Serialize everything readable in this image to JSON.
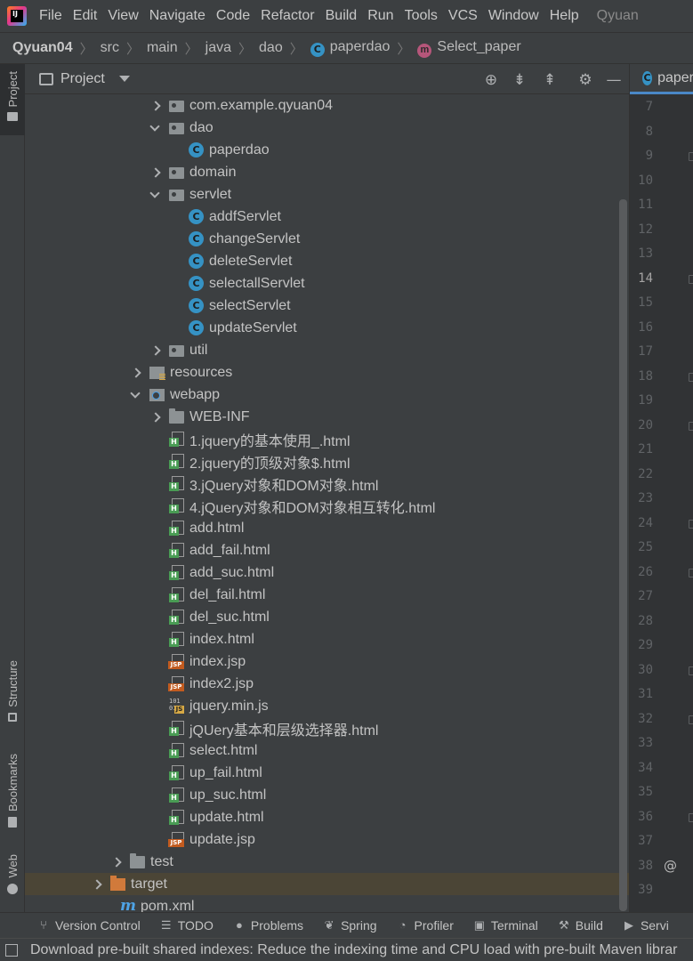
{
  "menubar": {
    "items": [
      "File",
      "Edit",
      "View",
      "Navigate",
      "Code",
      "Refactor",
      "Build",
      "Run",
      "Tools",
      "VCS",
      "Window",
      "Help"
    ],
    "title": "Qyuan"
  },
  "breadcrumb": {
    "project": "Qyuan04",
    "parts": [
      "src",
      "main",
      "java",
      "dao"
    ],
    "class_name": "paperdao",
    "method_name": "Select_paper"
  },
  "left_strip": {
    "project": "Project",
    "structure": "Structure",
    "bookmarks": "Bookmarks",
    "web": "Web"
  },
  "panel": {
    "title": "Project",
    "icons": [
      "locate-icon",
      "expand-all-icon",
      "collapse-all-icon",
      "gear-icon",
      "minimize-icon"
    ]
  },
  "tree": [
    {
      "label": "com.example.qyuan04",
      "icon": "package-icon",
      "arrow": "right",
      "depth": 2
    },
    {
      "label": "dao",
      "icon": "package-icon",
      "arrow": "down",
      "depth": 2
    },
    {
      "label": "paperdao",
      "icon": "class-icon",
      "arrow": "",
      "depth": 3
    },
    {
      "label": "domain",
      "icon": "package-icon",
      "arrow": "right",
      "depth": 2
    },
    {
      "label": "servlet",
      "icon": "package-icon",
      "arrow": "down",
      "depth": 2
    },
    {
      "label": "addfServlet",
      "icon": "class-icon",
      "arrow": "",
      "depth": 3
    },
    {
      "label": "changeServlet",
      "icon": "class-icon",
      "arrow": "",
      "depth": 3
    },
    {
      "label": "deleteServlet",
      "icon": "class-icon",
      "arrow": "",
      "depth": 3
    },
    {
      "label": "selectallServlet",
      "icon": "class-icon",
      "arrow": "",
      "depth": 3
    },
    {
      "label": "selectServlet",
      "icon": "class-icon",
      "arrow": "",
      "depth": 3
    },
    {
      "label": "updateServlet",
      "icon": "class-icon",
      "arrow": "",
      "depth": 3
    },
    {
      "label": "util",
      "icon": "package-icon",
      "arrow": "right",
      "depth": 2
    },
    {
      "label": "resources",
      "icon": "resources-folder-icon",
      "arrow": "right",
      "depth": 1
    },
    {
      "label": "webapp",
      "icon": "web-folder-icon",
      "arrow": "down",
      "depth": 1
    },
    {
      "label": "WEB-INF",
      "icon": "folder-icon",
      "arrow": "right",
      "depth": 2
    },
    {
      "label": "1.jquery的基本使用_.html",
      "icon": "html-file-icon",
      "arrow": "",
      "depth": 2
    },
    {
      "label": "2.jquery的顶级对象$.html",
      "icon": "html-file-icon",
      "arrow": "",
      "depth": 2
    },
    {
      "label": "3.jQuery对象和DOM对象.html",
      "icon": "html-file-icon",
      "arrow": "",
      "depth": 2
    },
    {
      "label": "4.jQuery对象和DOM对象相互转化.html",
      "icon": "html-file-icon",
      "arrow": "",
      "depth": 2
    },
    {
      "label": "add.html",
      "icon": "html-file-icon",
      "arrow": "",
      "depth": 2
    },
    {
      "label": "add_fail.html",
      "icon": "html-file-icon",
      "arrow": "",
      "depth": 2
    },
    {
      "label": "add_suc.html",
      "icon": "html-file-icon",
      "arrow": "",
      "depth": 2
    },
    {
      "label": "del_fail.html",
      "icon": "html-file-icon",
      "arrow": "",
      "depth": 2
    },
    {
      "label": "del_suc.html",
      "icon": "html-file-icon",
      "arrow": "",
      "depth": 2
    },
    {
      "label": "index.html",
      "icon": "html-file-icon",
      "arrow": "",
      "depth": 2
    },
    {
      "label": "index.jsp",
      "icon": "jsp-file-icon",
      "arrow": "",
      "depth": 2
    },
    {
      "label": "index2.jsp",
      "icon": "jsp-file-icon",
      "arrow": "",
      "depth": 2
    },
    {
      "label": "jquery.min.js",
      "icon": "js-file-icon",
      "arrow": "",
      "depth": 2
    },
    {
      "label": "jQUery基本和层级选择器.html",
      "icon": "html-file-icon",
      "arrow": "",
      "depth": 2
    },
    {
      "label": "select.html",
      "icon": "html-file-icon",
      "arrow": "",
      "depth": 2
    },
    {
      "label": "up_fail.html",
      "icon": "html-file-icon",
      "arrow": "",
      "depth": 2
    },
    {
      "label": "up_suc.html",
      "icon": "html-file-icon",
      "arrow": "",
      "depth": 2
    },
    {
      "label": "update.html",
      "icon": "html-file-icon",
      "arrow": "",
      "depth": 2
    },
    {
      "label": "update.jsp",
      "icon": "jsp-file-icon",
      "arrow": "",
      "depth": 2
    },
    {
      "label": "test",
      "icon": "folder-icon",
      "arrow": "right",
      "depth": 0
    },
    {
      "label": "target",
      "icon": "excluded-folder-icon",
      "arrow": "right",
      "depth": -1,
      "selected": true
    },
    {
      "label": "pom.xml",
      "icon": "maven-icon",
      "arrow": "",
      "depth": -0.5
    }
  ],
  "editor": {
    "tab_label": "paper",
    "line_numbers": [
      "7",
      "8",
      "9",
      "10",
      "11",
      "12",
      "13",
      "14",
      "15",
      "16",
      "17",
      "18",
      "19",
      "20",
      "21",
      "22",
      "23",
      "24",
      "25",
      "26",
      "27",
      "28",
      "29",
      "30",
      "31",
      "32",
      "33",
      "34",
      "35",
      "36",
      "37",
      "38",
      "39"
    ],
    "current_line": "14",
    "override_marker": "@"
  },
  "bottom_tools": [
    {
      "label": "Version Control",
      "icon": "branch-icon"
    },
    {
      "label": "TODO",
      "icon": "list-icon"
    },
    {
      "label": "Problems",
      "icon": "info-icon"
    },
    {
      "label": "Spring",
      "icon": "spring-icon"
    },
    {
      "label": "Profiler",
      "icon": "profiler-icon"
    },
    {
      "label": "Terminal",
      "icon": "terminal-icon"
    },
    {
      "label": "Build",
      "icon": "hammer-icon"
    },
    {
      "label": "Servi",
      "icon": "play-icon"
    }
  ],
  "status": {
    "message": "Download pre-built shared indexes: Reduce the indexing time and CPU load with pre-built Maven librar"
  },
  "colors": {
    "background": "#2b2b2b",
    "panel": "#3c3f41",
    "selection": "#4b4536",
    "class_icon": "#3592c4",
    "html_badge": "#499c54",
    "jsp_badge": "#c25b1f",
    "accent": "#4a88c7"
  }
}
